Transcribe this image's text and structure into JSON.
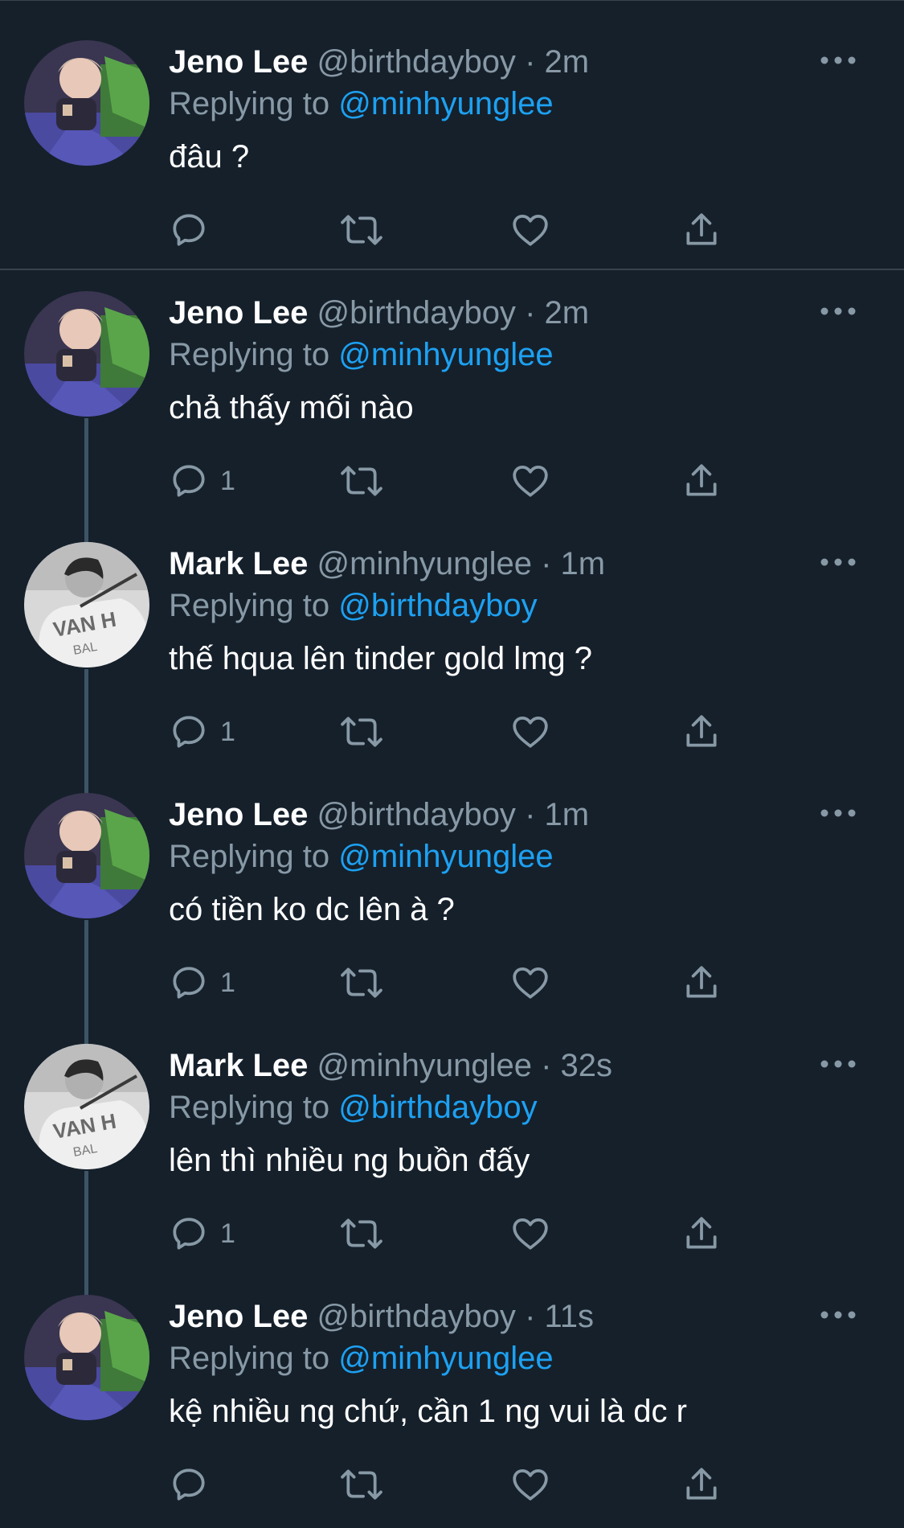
{
  "colors": {
    "background": "#15202b",
    "secondary_text": "#8899a6",
    "mention": "#1da1f2",
    "divider": "#38444d"
  },
  "tweets": [
    {
      "name": "Jeno Lee",
      "handle": "@birthdayboy",
      "separator": "·",
      "time": "2m",
      "replying_prefix": "Replying to",
      "replying_to": "@minhyunglee",
      "text": "đâu ?",
      "reply_count": "",
      "avatar": "jeno-avatar"
    },
    {
      "name": "Jeno Lee",
      "handle": "@birthdayboy",
      "separator": "·",
      "time": "2m",
      "replying_prefix": "Replying to",
      "replying_to": "@minhyunglee",
      "text": "chả thấy mối nào",
      "reply_count": "1",
      "avatar": "jeno-avatar"
    },
    {
      "name": "Mark Lee",
      "handle": "@minhyunglee",
      "separator": "·",
      "time": "1m",
      "replying_prefix": "Replying to",
      "replying_to": "@birthdayboy",
      "text": "thế hqua lên tinder gold lmg ?",
      "reply_count": "1",
      "avatar": "mark-avatar"
    },
    {
      "name": "Jeno Lee",
      "handle": "@birthdayboy",
      "separator": "·",
      "time": "1m",
      "replying_prefix": "Replying to",
      "replying_to": "@minhyunglee",
      "text": "có tiền ko dc lên à ?",
      "reply_count": "1",
      "avatar": "jeno-avatar"
    },
    {
      "name": "Mark Lee",
      "handle": "@minhyunglee",
      "separator": "·",
      "time": "32s",
      "replying_prefix": "Replying to",
      "replying_to": "@birthdayboy",
      "text": "lên thì nhiều ng buồn đấy",
      "reply_count": "1",
      "avatar": "mark-avatar"
    },
    {
      "name": "Jeno Lee",
      "handle": "@birthdayboy",
      "separator": "·",
      "time": "11s",
      "replying_prefix": "Replying to",
      "replying_to": "@minhyunglee",
      "text": "kệ nhiều ng chứ, cần 1 ng vui là dc r",
      "reply_count": "",
      "avatar": "jeno-avatar"
    }
  ],
  "avatar_print": "VAN H",
  "avatar_print_2": "BAL"
}
